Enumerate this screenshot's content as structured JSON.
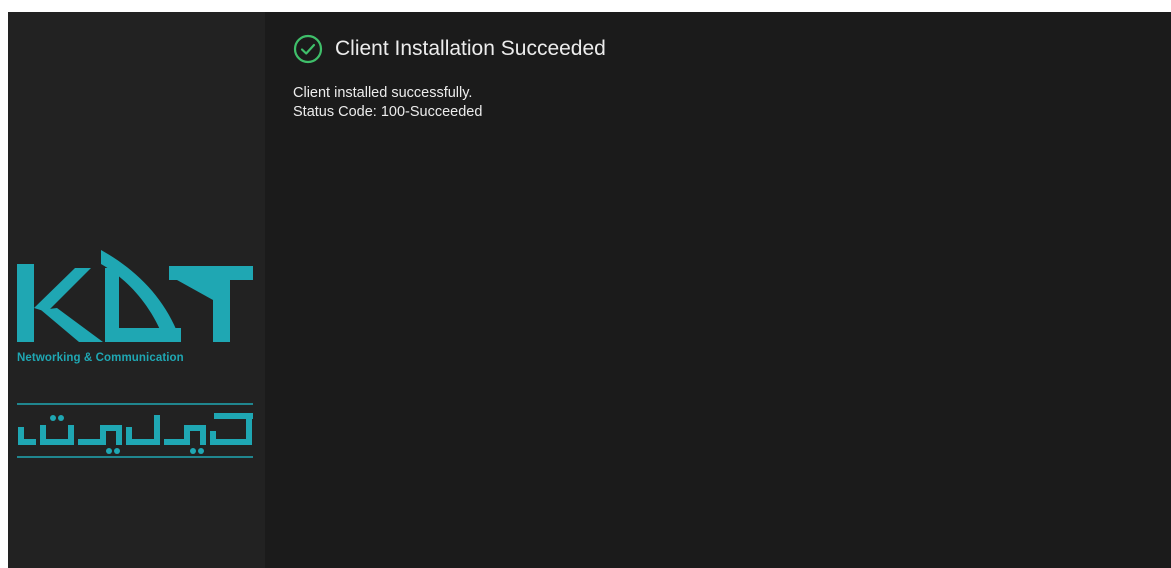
{
  "sidebar": {
    "logo": {
      "tagline": "Networking & Communication",
      "mark_text": "KDT",
      "persian_text": "کی دی تی",
      "brand_color": "#1fa7b3"
    }
  },
  "main": {
    "status_icon": "check-circle-icon",
    "status_color": "#3fbf6a",
    "title": "Client Installation Succeeded",
    "message_line1": "Client installed successfully.",
    "message_line2": "Status Code: 100-Succeeded"
  }
}
